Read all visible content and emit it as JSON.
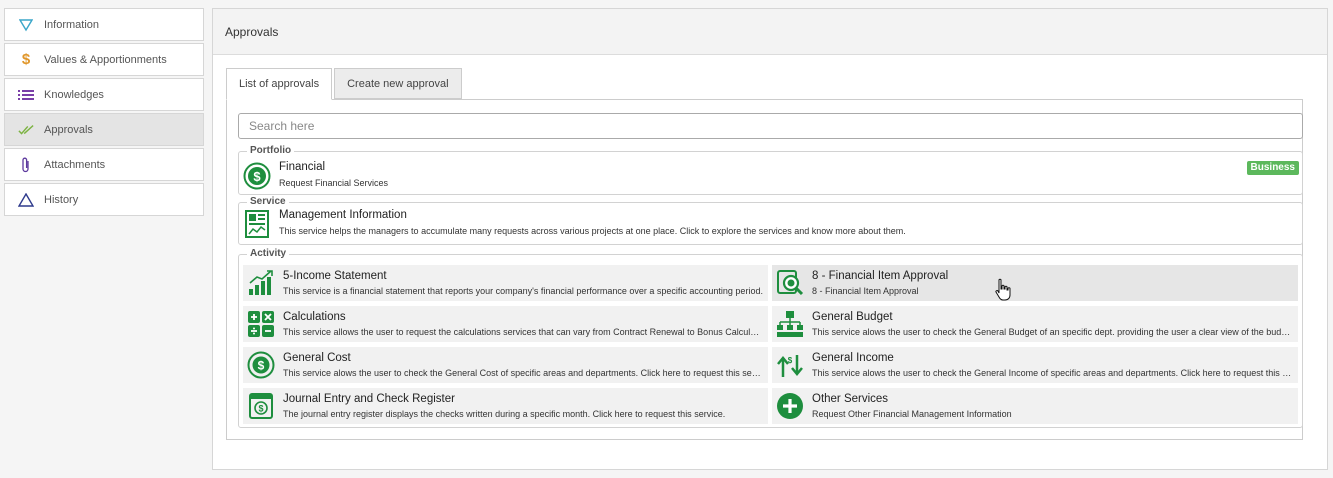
{
  "colors": {
    "accent_green": "#1e8e3e",
    "badge_green": "#5cb85c"
  },
  "sidebar": {
    "items": [
      {
        "label": "Information",
        "icon": "filter-icon"
      },
      {
        "label": "Values & Apportionments",
        "icon": "dollar-icon"
      },
      {
        "label": "Knowledges",
        "icon": "list-icon"
      },
      {
        "label": "Approvals",
        "icon": "double-check-icon",
        "active": true
      },
      {
        "label": "Attachments",
        "icon": "paperclip-icon"
      },
      {
        "label": "History",
        "icon": "triangle-icon"
      }
    ]
  },
  "main": {
    "title": "Approvals",
    "tabs": [
      {
        "label": "List of approvals",
        "active": true
      },
      {
        "label": "Create new approval",
        "active": false
      }
    ],
    "search": {
      "placeholder": "Search here",
      "value": ""
    },
    "portfolio": {
      "label": "Portfolio",
      "title": "Financial",
      "description": "Request Financial Services",
      "badge": "Business"
    },
    "service": {
      "label": "Service",
      "title": "Management Information",
      "description": "This service helps the managers to accumulate many requests across various projects at one place. Click to explore the services and know more about them."
    },
    "activity": {
      "label": "Activity",
      "items": [
        {
          "title": "5-Income Statement",
          "description": "This service is a financial statement that reports your company's financial performance over a specific accounting period.",
          "icon": "bar-chart-icon"
        },
        {
          "title": "8 - Financial Item Approval",
          "description": "8 - Financial Item Approval",
          "icon": "approval-search-icon"
        },
        {
          "title": "Calculations",
          "description": "This service allows the user to request the calculations services that can vary from Contract Renewal to Bonus Calculations.",
          "icon": "calculator-icon"
        },
        {
          "title": "General Budget",
          "description": "This service alows the user to check the General Budget of an specific dept. providing the user a clear view of the budget.",
          "icon": "org-chart-icon"
        },
        {
          "title": "General Cost",
          "description": "This service alows the user to check the General Cost of specific areas and departments. Click here to request this service.",
          "icon": "coin-icon"
        },
        {
          "title": "General Income",
          "description": "This service alows the user to check the General Income of specific areas and departments. Click here to request this service.",
          "icon": "income-arrows-icon"
        },
        {
          "title": "Journal Entry and Check Register",
          "description": "The journal entry register displays the checks written during a specific month. Click here to request this service.",
          "icon": "register-icon"
        },
        {
          "title": "Other Services",
          "description": "Request Other Financial Management Information",
          "icon": "plus-circle-icon"
        }
      ]
    }
  }
}
